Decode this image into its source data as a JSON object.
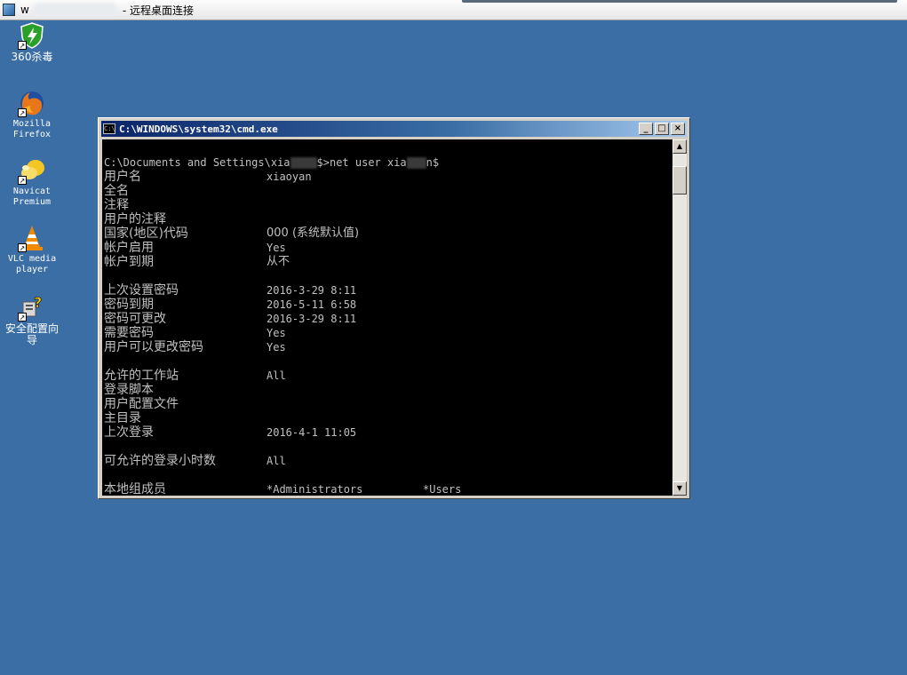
{
  "rdp": {
    "host": "w",
    "title": "- 远程桌面连接"
  },
  "desktop_icons": [
    {
      "label": "360杀毒",
      "icon": "shield-icon"
    },
    {
      "label": "Mozilla Firefox",
      "icon": "firefox-icon"
    },
    {
      "label": "Navicat Premium",
      "icon": "navicat-icon"
    },
    {
      "label": "VLC media player",
      "icon": "vlc-cone-icon"
    },
    {
      "label": "安全配置向导",
      "icon": "security-wizard-icon"
    }
  ],
  "cmd": {
    "title": "C:\\WINDOWS\\system32\\cmd.exe",
    "icon_text": "C:\\",
    "minimize": "_",
    "maximize": "□",
    "close": "×",
    "command_prompt_start": "C:\\Documents and Settings\\xia",
    "command_prompt_end": "$>net user xia",
    "command_tail": "n$",
    "rows": [
      {
        "key": "用户名",
        "value": "xiaoyan"
      },
      {
        "key": "全名",
        "value": ""
      },
      {
        "key": "注释",
        "value": ""
      },
      {
        "key": "用户的注释",
        "value": ""
      },
      {
        "key": "国家(地区)代码",
        "value": "000 (系统默认值)"
      },
      {
        "key": "帐户启用",
        "value": "Yes"
      },
      {
        "key": "帐户到期",
        "value": "从不"
      },
      {
        "key": "",
        "value": ""
      },
      {
        "key": "上次设置密码",
        "value": "2016-3-29 8:11"
      },
      {
        "key": "密码到期",
        "value": "2016-5-11 6:58"
      },
      {
        "key": "密码可更改",
        "value": "2016-3-29 8:11"
      },
      {
        "key": "需要密码",
        "value": "Yes"
      },
      {
        "key": "用户可以更改密码",
        "value": "Yes"
      },
      {
        "key": "",
        "value": ""
      },
      {
        "key": "允许的工作站",
        "value": "All"
      },
      {
        "key": "登录脚本",
        "value": ""
      },
      {
        "key": "用户配置文件",
        "value": ""
      },
      {
        "key": "主目录",
        "value": ""
      },
      {
        "key": "上次登录",
        "value": "2016-4-1 11:05"
      },
      {
        "key": "",
        "value": ""
      },
      {
        "key": "可允许的登录小时数",
        "value": "All"
      },
      {
        "key": "",
        "value": ""
      },
      {
        "key": "本地组成员",
        "value": "*Administrators",
        "value2": "*Users"
      }
    ]
  }
}
